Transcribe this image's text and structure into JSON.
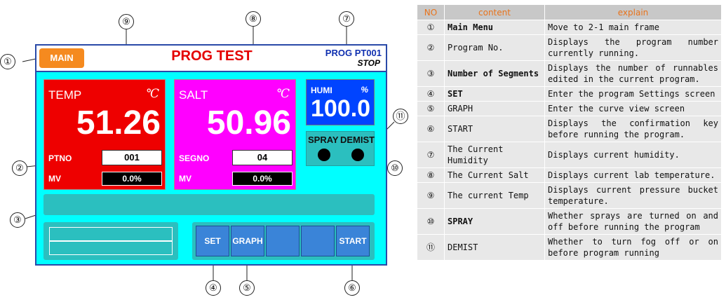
{
  "screen": {
    "main_button": "MAIN",
    "title": "PROG TEST",
    "program_label": "PROG PT001",
    "status": "STOP",
    "temp": {
      "label": "TEMP",
      "unit": "℃",
      "value": "51.26",
      "sub_label": "PTNO",
      "sub_value": "001",
      "mv_label": "MV",
      "mv_value": "0.0%"
    },
    "salt": {
      "label": "SALT",
      "unit": "℃",
      "value": "50.96",
      "sub_label": "SEGNO",
      "sub_value": "04",
      "mv_label": "MV",
      "mv_value": "0.0%"
    },
    "humi": {
      "label": "HUMI",
      "unit": "%",
      "value": "100.0"
    },
    "spray_label": "SPRAY",
    "demist_label": "DEMIST",
    "buttons": [
      "SET",
      "GRAPH",
      "",
      "",
      "START"
    ]
  },
  "callouts": [
    "①",
    "②",
    "③",
    "④",
    "⑤",
    "⑥",
    "⑦",
    "⑧",
    "⑨",
    "⑩",
    "⑪"
  ],
  "table": {
    "headers": [
      "NO",
      "content",
      "explain"
    ],
    "rows": [
      {
        "no": "①",
        "content": "Main Menu",
        "explain": "Move to 2-1 main frame",
        "bold": true
      },
      {
        "no": "②",
        "content": "Program No.",
        "explain": "Displays the program number currently running.",
        "bold": false
      },
      {
        "no": "③",
        "content": "Number of Segments",
        "explain": "Displays the number of runnables edited in the current program.",
        "bold": true
      },
      {
        "no": "④",
        "content": "SET",
        "explain": "Enter the program Settings screen",
        "bold": true
      },
      {
        "no": "⑤",
        "content": "GRAPH",
        "explain": "Enter the curve view screen",
        "bold": false
      },
      {
        "no": "⑥",
        "content": "START",
        "explain": "Displays the confirmation key before running the program.",
        "bold": false
      },
      {
        "no": "⑦",
        "content": "The Current Humidity",
        "explain": "Displays current humidity.",
        "bold": false
      },
      {
        "no": "⑧",
        "content": "The Current Salt",
        "explain": "Displays current lab temperature.",
        "bold": false
      },
      {
        "no": "⑨",
        "content": "The current Temp",
        "explain": "Displays current pressure bucket temperature.",
        "bold": false
      },
      {
        "no": "⑩",
        "content": "SPRAY",
        "explain": "Whether sprays are turned on and off before running the program",
        "bold": true
      },
      {
        "no": "⑪",
        "content": "DEMIST",
        "explain": "Whether to turn fog off or on before program running",
        "bold": false
      }
    ]
  },
  "colors": {
    "screen_bg": "#00ffff",
    "temp_panel": "#ee0000",
    "salt_panel": "#ff00ff",
    "humi_panel": "#0044ff",
    "main_button": "#f58a1f",
    "title": "#e40000",
    "button": "#3a84d8"
  }
}
